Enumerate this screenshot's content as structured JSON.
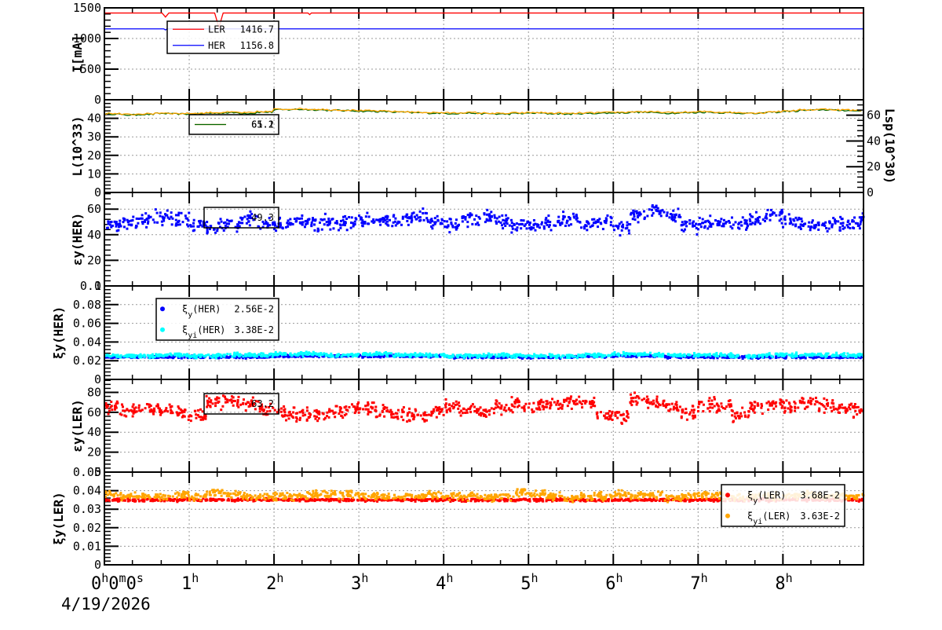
{
  "chart_data": [
    {
      "type": "line",
      "id": "current",
      "ylabel": "I[mA]",
      "ylim": [
        0,
        1500
      ],
      "yticks": [
        "0",
        "500",
        "1000",
        "1500"
      ],
      "ytick_values": [
        0,
        500,
        1000,
        1500
      ],
      "legend": [
        {
          "name": "LER",
          "value": "1416.7",
          "color": "#ff0000"
        },
        {
          "name": "HER",
          "value": "1156.8",
          "color": "#0000ff"
        }
      ],
      "series": [
        {
          "name": "LER",
          "color": "#ff0000",
          "points": [
            [
              0,
              1416
            ],
            [
              0.68,
              1416
            ],
            [
              0.72,
              1350
            ],
            [
              0.76,
              1416
            ],
            [
              1.3,
              1416
            ],
            [
              1.35,
              1180
            ],
            [
              1.4,
              1416
            ],
            [
              2.4,
              1416
            ],
            [
              2.42,
              1390
            ],
            [
              2.44,
              1416
            ],
            [
              8.95,
              1416
            ]
          ]
        },
        {
          "name": "HER",
          "color": "#0000ff",
          "points": [
            [
              0,
              1157
            ],
            [
              0.7,
              1157
            ],
            [
              0.72,
              1140
            ],
            [
              0.74,
              1157
            ],
            [
              8.95,
              1157
            ]
          ]
        }
      ]
    },
    {
      "type": "line",
      "id": "luminosity",
      "ylabel": "L(10^33)",
      "ylim": [
        0,
        50
      ],
      "yticks": [
        "0",
        "10",
        "20",
        "30",
        "40"
      ],
      "ytick_values": [
        0,
        10,
        20,
        30,
        40
      ],
      "y2label": "Lsp(10^30)",
      "y2lim": [
        0,
        72
      ],
      "y2ticks": [
        "0",
        "20",
        "40",
        "60"
      ],
      "y2tick_values": [
        0,
        20,
        40,
        60
      ],
      "legend": [
        {
          "name": "",
          "value": "65.2",
          "color": "#ffa500"
        },
        {
          "name": "",
          "value": "61.1",
          "color": "#006400"
        }
      ],
      "t_step": 0.2,
      "series": [
        {
          "name": "L",
          "color": "#006400",
          "values": [
            42.3,
            41.8,
            42.1,
            42.6,
            42.3,
            42.4,
            42.8,
            43.0,
            42.7,
            43.3,
            44.6,
            44.8,
            44.6,
            44.3,
            44.1,
            43.8,
            43.6,
            43.3,
            43.0,
            42.8,
            42.6,
            42.8,
            42.5,
            42.3,
            42.6,
            42.8,
            42.5,
            42.3,
            42.6,
            42.8,
            43.0,
            43.3,
            43.1,
            42.8,
            43.0,
            43.3,
            43.0,
            42.8,
            42.6,
            43.3,
            43.8,
            44.3,
            44.6,
            44.3,
            44.0,
            44.3
          ]
        },
        {
          "name": "Lsp",
          "color": "#ffa500",
          "values": [
            42.6,
            42.1,
            42.4,
            42.9,
            42.6,
            42.7,
            43.1,
            43.3,
            43.0,
            43.6,
            44.9,
            45.1,
            44.9,
            44.6,
            44.4,
            44.1,
            43.9,
            43.6,
            43.3,
            43.1,
            42.9,
            43.1,
            42.8,
            42.6,
            42.9,
            43.1,
            42.8,
            42.6,
            42.9,
            43.1,
            43.3,
            43.6,
            43.4,
            43.1,
            43.3,
            43.6,
            43.3,
            43.1,
            42.9,
            43.6,
            44.1,
            44.6,
            44.9,
            44.6,
            44.3,
            44.6
          ]
        }
      ]
    },
    {
      "type": "scatter",
      "id": "emit-her",
      "ylabel": "εy(HER)",
      "ylim": [
        0,
        73
      ],
      "yticks": [
        "0",
        "20",
        "40",
        "60"
      ],
      "ytick_values": [
        0,
        20,
        40,
        60
      ],
      "legend": [
        {
          "name": "",
          "value": "49.3",
          "color": "#0000ff"
        }
      ],
      "t_step": 0.2,
      "series": [
        {
          "name": "εy(HER)",
          "color": "#0000ff",
          "spread": 4,
          "values": [
            48,
            50,
            52,
            53,
            51,
            47,
            46,
            48,
            52,
            49,
            48,
            50,
            48,
            49,
            50,
            51,
            50,
            52,
            54,
            50,
            48,
            52,
            54,
            50,
            47,
            47,
            48,
            52,
            48,
            50,
            46,
            55,
            58,
            54,
            47,
            49,
            50,
            48,
            52,
            55,
            51,
            47,
            48,
            49,
            50,
            48
          ]
        }
      ]
    },
    {
      "type": "scatter",
      "id": "tune-her",
      "ylabel": "ξy(HER)",
      "ylim": [
        0,
        0.1
      ],
      "yticks": [
        "0",
        "0.02",
        "0.04",
        "0.06",
        "0.08",
        "0.1"
      ],
      "ytick_values": [
        0,
        0.02,
        0.04,
        0.06,
        0.08,
        0.1
      ],
      "legend": [
        {
          "name": "ξy(HER)",
          "value": "2.56E-2",
          "color": "#0000ff"
        },
        {
          "name": "ξyi(HER)",
          "value": "3.38E-2",
          "color": "#00ffff"
        }
      ],
      "t_step": 0.2,
      "series": [
        {
          "name": "ξy(HER)",
          "color": "#0000ff",
          "spread": 0.001,
          "values": [
            0.024,
            0.024,
            0.024,
            0.024,
            0.024,
            0.024,
            0.024,
            0.024,
            0.024,
            0.024,
            0.025,
            0.025,
            0.025,
            0.025,
            0.025,
            0.025,
            0.025,
            0.025,
            0.025,
            0.025,
            0.024,
            0.024,
            0.024,
            0.024,
            0.024,
            0.024,
            0.024,
            0.024,
            0.025,
            0.025,
            0.025,
            0.025,
            0.025,
            0.024,
            0.024,
            0.024,
            0.024,
            0.024,
            0.024,
            0.024,
            0.024,
            0.024,
            0.024,
            0.024,
            0.024,
            0.024
          ]
        },
        {
          "name": "ξyi(HER)",
          "color": "#00ffff",
          "spread": 0.0015,
          "values": [
            0.025,
            0.025,
            0.025,
            0.026,
            0.026,
            0.025,
            0.025,
            0.026,
            0.026,
            0.026,
            0.027,
            0.027,
            0.027,
            0.026,
            0.026,
            0.027,
            0.027,
            0.026,
            0.026,
            0.026,
            0.025,
            0.025,
            0.026,
            0.026,
            0.025,
            0.025,
            0.025,
            0.025,
            0.026,
            0.026,
            0.027,
            0.027,
            0.026,
            0.026,
            0.026,
            0.026,
            0.026,
            0.025,
            0.025,
            0.026,
            0.026,
            0.026,
            0.026,
            0.026,
            0.026,
            0.026
          ]
        }
      ]
    },
    {
      "type": "scatter",
      "id": "emit-ler",
      "ylabel": "εy(LER)",
      "ylim": [
        0,
        93
      ],
      "yticks": [
        "0",
        "20",
        "40",
        "60",
        "80"
      ],
      "ytick_values": [
        0,
        20,
        40,
        60,
        80
      ],
      "legend": [
        {
          "name": "",
          "value": "63.2",
          "color": "#ff0000"
        }
      ],
      "t_step": 0.2,
      "series": [
        {
          "name": "εy(LER)",
          "color": "#ff0000",
          "spread": 5,
          "values": [
            65,
            62,
            64,
            63,
            60,
            58,
            70,
            72,
            68,
            62,
            60,
            58,
            58,
            60,
            62,
            63,
            60,
            58,
            57,
            60,
            66,
            62,
            60,
            65,
            68,
            66,
            68,
            72,
            70,
            58,
            56,
            73,
            68,
            64,
            60,
            68,
            65,
            58,
            66,
            68,
            66,
            70,
            66,
            64,
            62,
            63
          ]
        }
      ]
    },
    {
      "type": "scatter",
      "id": "tune-ler",
      "ylabel": "ξy(LER)",
      "ylim": [
        0,
        0.05
      ],
      "yticks": [
        "0",
        "0.01",
        "0.02",
        "0.03",
        "0.04",
        "0.05"
      ],
      "ytick_values": [
        0,
        0.01,
        0.02,
        0.03,
        0.04,
        0.05
      ],
      "legend": [
        {
          "name": "ξy(LER)",
          "value": "3.68E-2",
          "color": "#ff0000"
        },
        {
          "name": "ξyi(LER)",
          "value": "3.63E-2",
          "color": "#ffa500"
        }
      ],
      "t_step": 0.2,
      "series": [
        {
          "name": "ξy(LER)",
          "color": "#ff0000",
          "spread": 0.0006,
          "values": [
            0.035,
            0.035,
            0.035,
            0.035,
            0.035,
            0.035,
            0.035,
            0.035,
            0.035,
            0.035,
            0.035,
            0.035,
            0.035,
            0.035,
            0.035,
            0.035,
            0.035,
            0.035,
            0.035,
            0.035,
            0.035,
            0.035,
            0.035,
            0.035,
            0.035,
            0.035,
            0.035,
            0.035,
            0.035,
            0.035,
            0.035,
            0.035,
            0.035,
            0.035,
            0.035,
            0.035,
            0.035,
            0.035,
            0.035,
            0.035,
            0.035,
            0.035,
            0.035,
            0.035,
            0.035,
            0.035
          ]
        },
        {
          "name": "ξyi(LER)",
          "color": "#ffa500",
          "spread": 0.0015,
          "values": [
            0.038,
            0.037,
            0.037,
            0.037,
            0.038,
            0.037,
            0.039,
            0.038,
            0.037,
            0.037,
            0.037,
            0.037,
            0.038,
            0.038,
            0.038,
            0.037,
            0.037,
            0.037,
            0.037,
            0.038,
            0.037,
            0.037,
            0.036,
            0.037,
            0.039,
            0.038,
            0.037,
            0.036,
            0.037,
            0.037,
            0.038,
            0.037,
            0.038,
            0.036,
            0.037,
            0.038,
            0.037,
            0.036,
            0.037,
            0.037,
            0.037,
            0.038,
            0.037,
            0.037,
            0.037,
            0.038
          ]
        }
      ]
    }
  ],
  "xaxis": {
    "xlim_hours": [
      0,
      8.95
    ],
    "tick_values": [
      0,
      1,
      2,
      3,
      4,
      5,
      6,
      7,
      8
    ],
    "tick_labels": [
      "0h0m0s",
      "1h",
      "2h",
      "3h",
      "4h",
      "5h",
      "6h",
      "7h",
      "8h"
    ],
    "date": "4/19/2026"
  }
}
